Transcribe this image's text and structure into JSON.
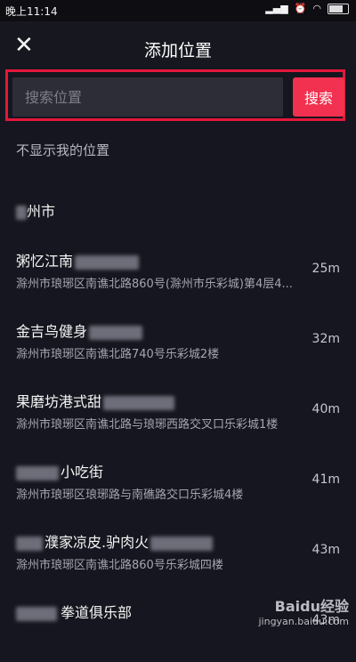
{
  "status_bar": {
    "time": "晚上11:14"
  },
  "header": {
    "title": "添加位置"
  },
  "search": {
    "placeholder": "搜索位置",
    "button_label": "搜索"
  },
  "no_location_label": "不显示我的位置",
  "city_label": "州市",
  "locations": [
    {
      "name": "粥忆江南",
      "address": "滁州市琅琊区南谯北路860号(滁州市乐彩城)第4层4...",
      "distance": "25m"
    },
    {
      "name": "金吉鸟健身",
      "address": "滁州市琅琊区南谯北路740号乐彩城2楼",
      "distance": "32m"
    },
    {
      "name": "果磨坊港式甜",
      "address": "滁州市琅琊区南谯北路与琅琊西路交叉口乐彩城1楼",
      "distance": "40m"
    },
    {
      "name": "小吃街",
      "address": "滁州市琅琊区琅琊路与南礁路交口乐彩城4楼",
      "distance": "41m"
    },
    {
      "name": "濮家凉皮.驴肉火",
      "address": "滁州市琅琊区南谯北路860号乐彩城四楼",
      "distance": "43m"
    },
    {
      "name": "拳道俱乐部",
      "address": "",
      "distance": "43m"
    }
  ],
  "watermark": {
    "brand": "Baidu经验",
    "url": "jingyan.baidu.com"
  }
}
